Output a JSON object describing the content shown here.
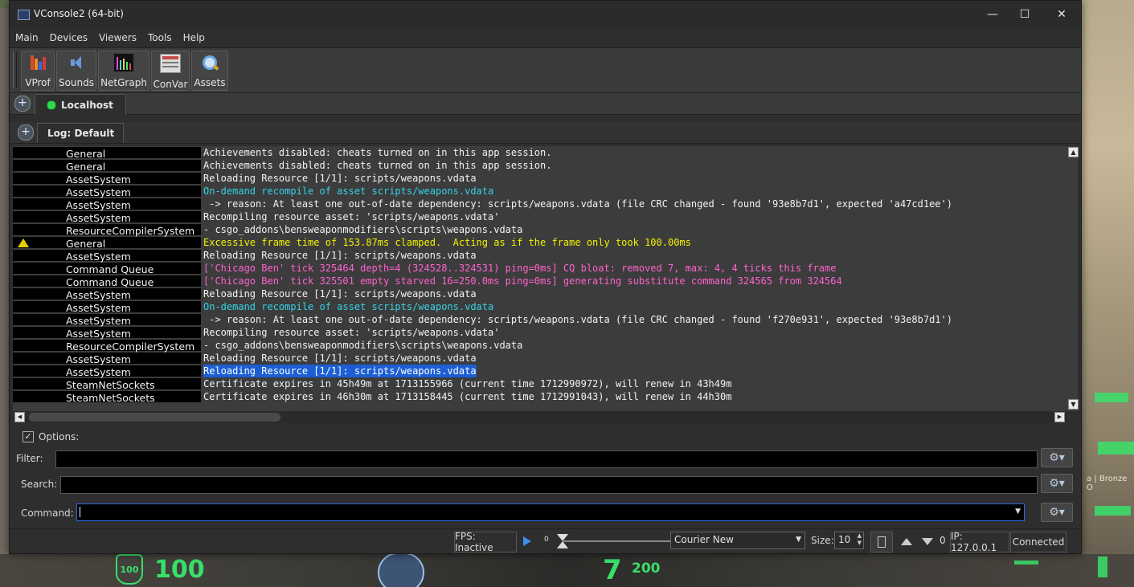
{
  "window": {
    "title": "VConsole2 (64-bit)",
    "controls": {
      "minimize": "—",
      "maximize": "☐",
      "close": "✕"
    }
  },
  "menu": [
    "Main",
    "Devices",
    "Viewers",
    "Tools",
    "Help"
  ],
  "toolbar": {
    "buttons": [
      {
        "label": "VProf",
        "icon": "vprof-icon"
      },
      {
        "label": "Sounds",
        "icon": "sounds-icon"
      },
      {
        "label": "NetGraph",
        "icon": "netgraph-icon"
      },
      {
        "label": "ConVar",
        "icon": "convar-icon"
      },
      {
        "label": "Assets",
        "icon": "assets-icon"
      }
    ]
  },
  "connection_tab": {
    "label": "Localhost",
    "status_color": "#2fd84a"
  },
  "log_tab": {
    "label": "Log: Default"
  },
  "log": {
    "rows": [
      {
        "category": "General",
        "message": "Achievements disabled: cheats turned on in this app session.",
        "style": "normal"
      },
      {
        "category": "General",
        "message": "Achievements disabled: cheats turned on in this app session.",
        "style": "normal"
      },
      {
        "category": "AssetSystem",
        "message": "Reloading Resource [1/1]: scripts/weapons.vdata",
        "style": "normal"
      },
      {
        "category": "AssetSystem",
        "message": "On-demand recompile of asset scripts/weapons.vdata",
        "style": "cyan"
      },
      {
        "category": "AssetSystem",
        "message": " -> reason: At least one out-of-date dependency: scripts/weapons.vdata (file CRC changed - found '93e8b7d1', expected 'a47cd1ee')",
        "style": "normal"
      },
      {
        "category": "AssetSystem",
        "message": "Recompiling resource asset: 'scripts/weapons.vdata'",
        "style": "normal"
      },
      {
        "category": "ResourceCompilerSystem",
        "message": "- csgo_addons\\bensweaponmodifiers\\scripts\\weapons.vdata",
        "style": "normal"
      },
      {
        "category": "General",
        "message": "Excessive frame time of 153.87ms clamped.  Acting as if the frame only took 100.00ms",
        "style": "yellow",
        "warning": true
      },
      {
        "category": "AssetSystem",
        "message": "Reloading Resource [1/1]: scripts/weapons.vdata",
        "style": "normal"
      },
      {
        "category": "Command Queue",
        "message": "['Chicago Ben' tick 325464 depth=4 (324528..324531) ping=0ms] CQ bloat: removed 7, max: 4, 4 ticks this frame",
        "style": "pink"
      },
      {
        "category": "Command Queue",
        "message": "['Chicago Ben' tick 325501 empty starved 16=250.0ms ping=0ms] generating substitute command 324565 from 324564",
        "style": "pink"
      },
      {
        "category": "AssetSystem",
        "message": "Reloading Resource [1/1]: scripts/weapons.vdata",
        "style": "normal"
      },
      {
        "category": "AssetSystem",
        "message": "On-demand recompile of asset scripts/weapons.vdata",
        "style": "cyan"
      },
      {
        "category": "AssetSystem",
        "message": " -> reason: At least one out-of-date dependency: scripts/weapons.vdata (file CRC changed - found 'f270e931', expected '93e8b7d1')",
        "style": "normal"
      },
      {
        "category": "AssetSystem",
        "message": "Recompiling resource asset: 'scripts/weapons.vdata'",
        "style": "normal"
      },
      {
        "category": "ResourceCompilerSystem",
        "message": "- csgo_addons\\bensweaponmodifiers\\scripts\\weapons.vdata",
        "style": "normal"
      },
      {
        "category": "AssetSystem",
        "message": "Reloading Resource [1/1]: scripts/weapons.vdata",
        "style": "normal"
      },
      {
        "category": "AssetSystem",
        "message": "Reloading Resource [1/1]: scripts/weapons.vdata",
        "style": "sel"
      },
      {
        "category": "SteamNetSockets",
        "message": "Certificate expires in 45h49m at 1713155966 (current time 1712990972), will renew in 43h49m",
        "style": "normal"
      },
      {
        "category": "SteamNetSockets",
        "message": "Certificate expires in 46h30m at 1713158445 (current time 1712991043), will renew in 44h30m",
        "style": "normal"
      }
    ]
  },
  "options": {
    "label": "Options:",
    "checked": true,
    "filter_label": "Filter:",
    "filter_value": "",
    "search_label": "Search:",
    "search_value": "",
    "command_label": "Command:",
    "command_value": ""
  },
  "status": {
    "fps": "FPS: Inactive",
    "slider_value": "0",
    "font": "Courier New",
    "size_label": "Size:",
    "size_value": "10",
    "count": "0",
    "ip": "IP: 127.0.0.1",
    "connection": "Connected"
  },
  "hud": {
    "shield": "100",
    "health": "100",
    "ammo": "7",
    "reserve": "200",
    "rank_text": "a | Bronze O"
  },
  "colors": {
    "accent": "#2a6ef0",
    "selection": "#1c5fd4",
    "cyan_text": "#35d2e8",
    "warning_text": "#f2f000",
    "pink_text": "#ff62ce",
    "hud_green": "#38e06a"
  }
}
